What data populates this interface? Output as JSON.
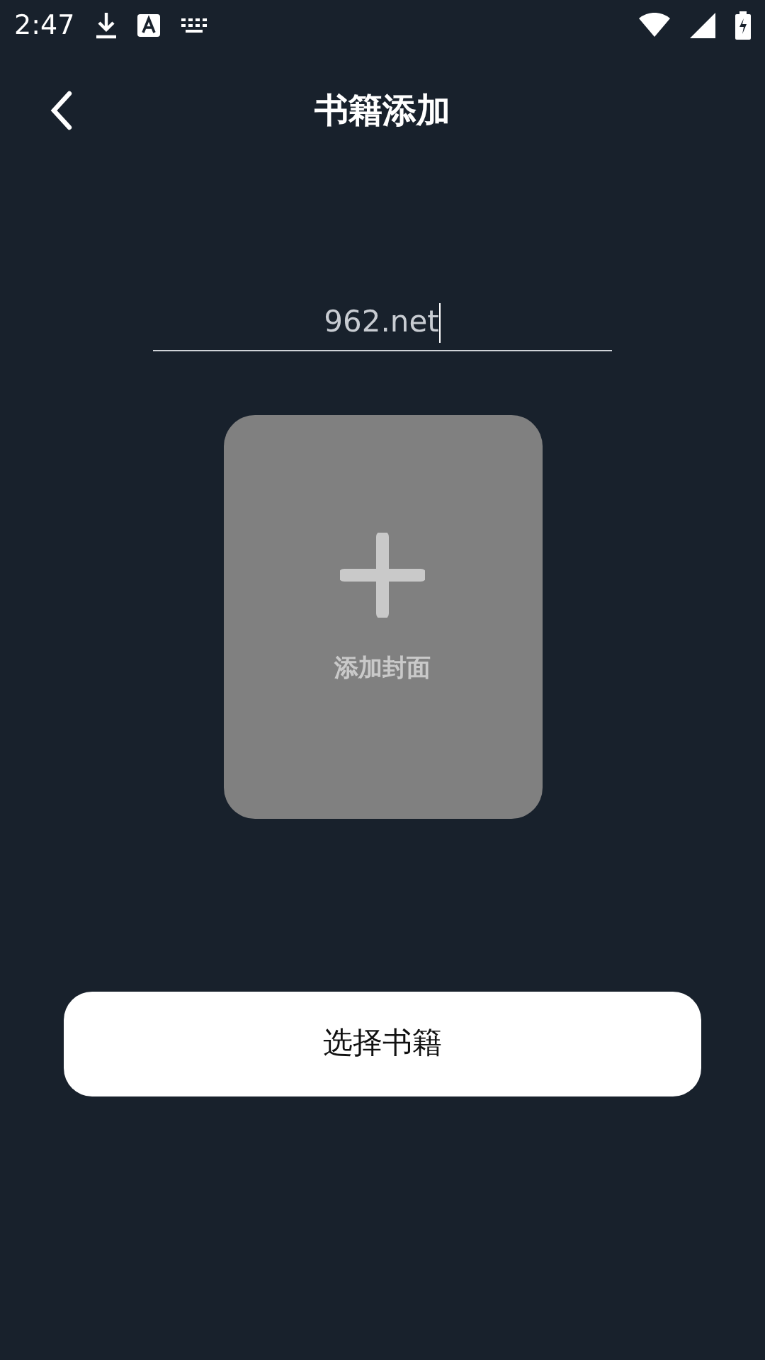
{
  "status_bar": {
    "time": "2:47"
  },
  "header": {
    "title": "书籍添加"
  },
  "name_field": {
    "value": "962.net",
    "focused": true
  },
  "cover": {
    "label": "添加封面"
  },
  "select_button": {
    "label": "选择书籍"
  }
}
